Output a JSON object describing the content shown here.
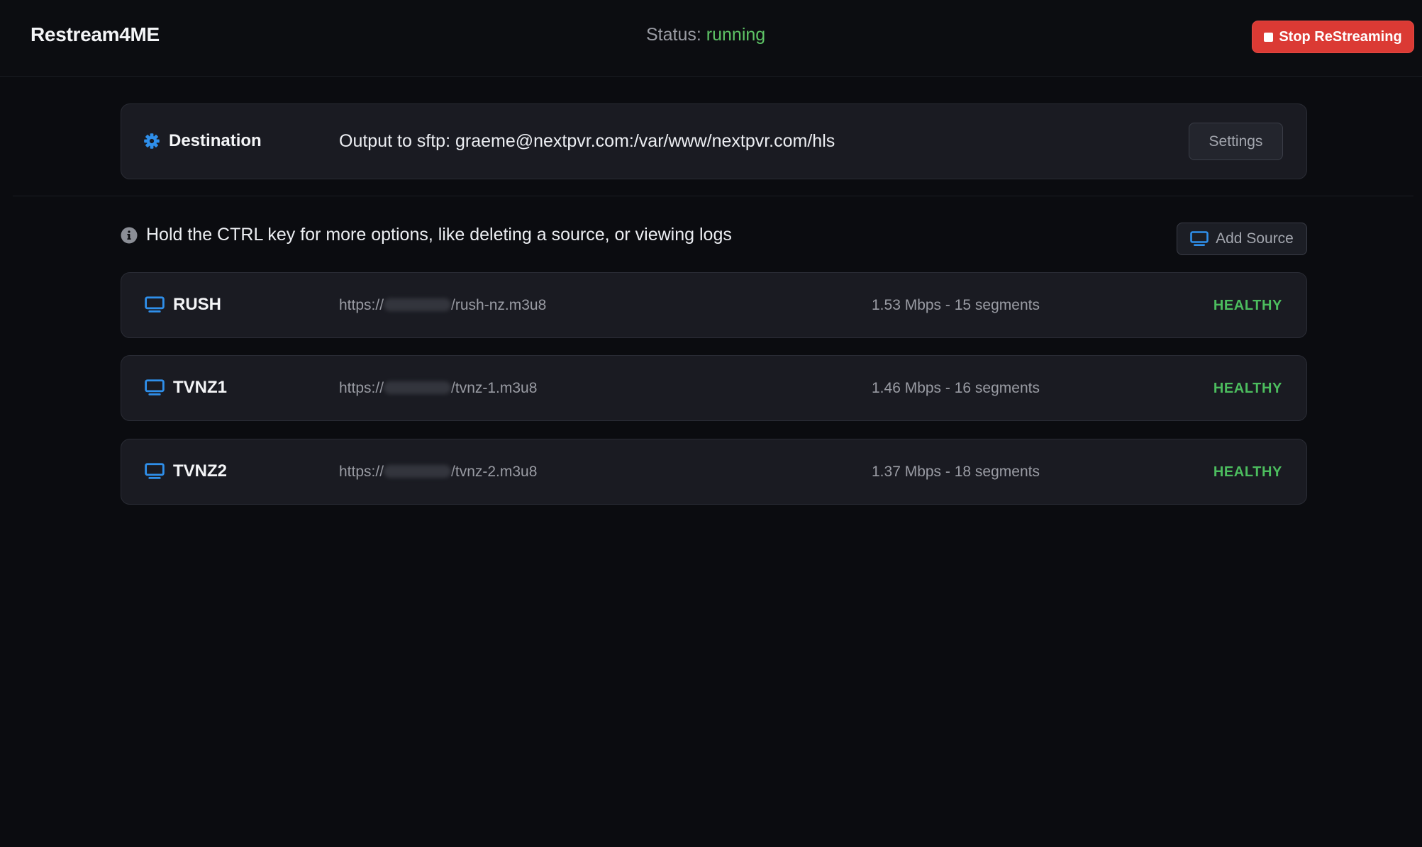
{
  "header": {
    "brand": "Restream4ME",
    "status_label": "Status:",
    "status_value": "running",
    "stop_button_label": "Stop ReStreaming"
  },
  "destination": {
    "title": "Destination",
    "output_text": "Output to sftp: graeme@nextpvr.com:/var/www/nextpvr.com/hls",
    "settings_label": "Settings",
    "icon": "gear-icon"
  },
  "hint": {
    "text": "Hold the CTRL key for more options, like deleting a source, or viewing logs",
    "icon": "info-icon"
  },
  "add_source": {
    "label": "Add Source",
    "icon": "monitor-icon"
  },
  "sources": [
    {
      "name": "RUSH",
      "url_prefix": "https://",
      "url_suffix": "/rush-nz.m3u8",
      "stats": "1.53 Mbps - 15 segments",
      "health": "HEALTHY"
    },
    {
      "name": "TVNZ1",
      "url_prefix": "https://",
      "url_suffix": "/tvnz-1.m3u8",
      "stats": "1.46 Mbps - 16 segments",
      "health": "HEALTHY"
    },
    {
      "name": "TVNZ2",
      "url_prefix": "https://",
      "url_suffix": "/tvnz-2.m3u8",
      "stats": "1.37 Mbps - 18 segments",
      "health": "HEALTHY"
    }
  ],
  "colors": {
    "background": "#0b0c10",
    "card": "#1a1b22",
    "accent_blue": "#2f8fea",
    "status_green": "#5ec466",
    "health_green": "#4cbd5e",
    "danger_red": "#db3a34"
  }
}
